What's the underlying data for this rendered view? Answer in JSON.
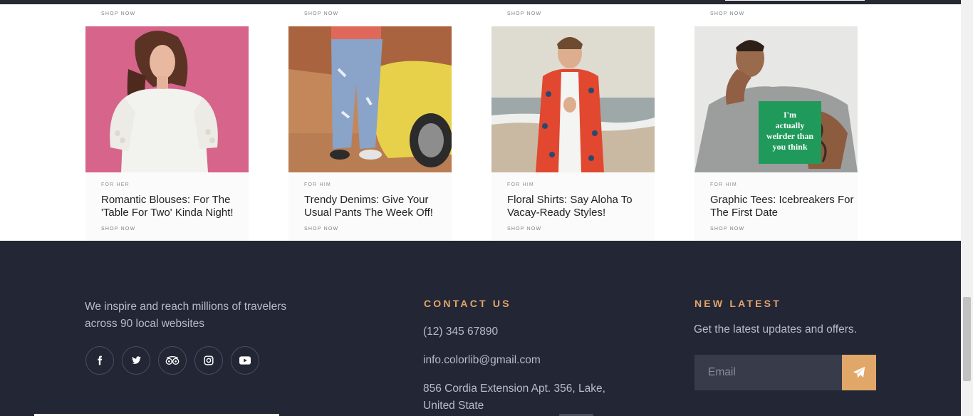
{
  "previous_row": {
    "shop_labels": [
      "SHOP NOW",
      "SHOP NOW",
      "SHOP NOW",
      "SHOP NOW"
    ]
  },
  "cards": [
    {
      "tag": "FOR HER",
      "title": "Romantic Blouses: For The 'Table For Two' Kinda Night!",
      "shop": "SHOP NOW"
    },
    {
      "tag": "FOR HIM",
      "title": "Trendy Denims:  Give Your Usual Pants The Week Off!",
      "shop": "SHOP NOW"
    },
    {
      "tag": "FOR HIM",
      "title": "Floral Shirts: Say Aloha To Vacay-Ready Styles!",
      "shop": "SHOP NOW"
    },
    {
      "tag": "FOR HIM",
      "title": "Graphic Tees: Icebreakers For The First Date",
      "shop": "SHOP NOW",
      "shirt_text": [
        "I'm",
        "actually",
        "weirder than",
        "you think"
      ]
    }
  ],
  "footer": {
    "about": "We inspire and reach millions of travelers across 90 local websites",
    "socials": [
      "facebook-icon",
      "twitter-icon",
      "tripadvisor-icon",
      "instagram-icon",
      "youtube-icon"
    ],
    "contact": {
      "title": "CONTACT US",
      "phone": "(12) 345 67890",
      "email": "info.colorlib@gmail.com",
      "address": "856 Cordia Extension Apt. 356, Lake, United State"
    },
    "newsletter": {
      "title": "NEW LATEST",
      "text": "Get the latest updates and offers.",
      "email_placeholder": "Email",
      "send_icon": "paper-plane-icon"
    }
  },
  "colors": {
    "footer_bg": "#232635",
    "accent": "#e3a56a",
    "footer_text": "#b9bcc6"
  }
}
